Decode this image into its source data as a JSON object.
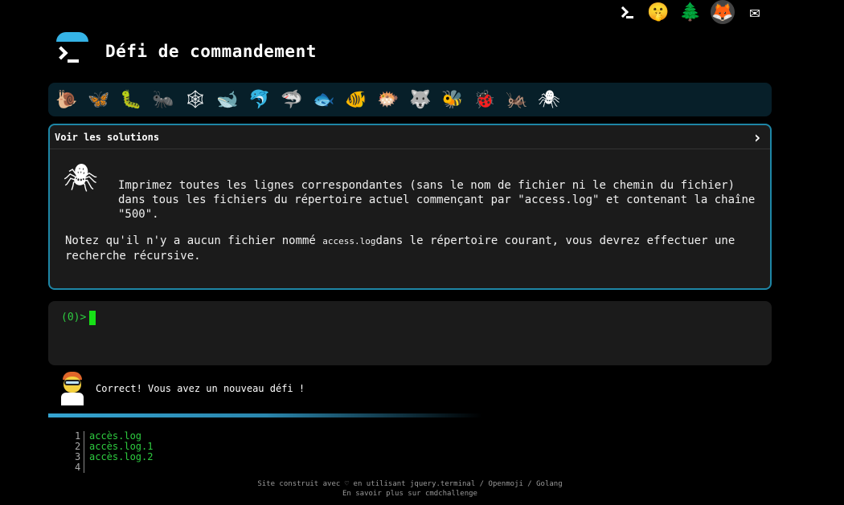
{
  "header": {
    "title": "Défi de commandement"
  },
  "top_icons": [
    {
      "name": "terminal-icon"
    },
    {
      "name": "shush-face-icon",
      "glyph": "🤫"
    },
    {
      "name": "tree-icon",
      "glyph": "🌲"
    },
    {
      "name": "gitlab-icon",
      "glyph": "🦊"
    },
    {
      "name": "mail-icon",
      "glyph": "✉"
    }
  ],
  "animals": [
    {
      "name": "snail-icon",
      "glyph": "🐌"
    },
    {
      "name": "butterfly-icon",
      "glyph": "🦋"
    },
    {
      "name": "caterpillar-icon",
      "glyph": "🐛"
    },
    {
      "name": "ant-icon",
      "glyph": "🐜"
    },
    {
      "name": "spider-web-icon",
      "glyph": "🕸"
    },
    {
      "name": "whale-icon",
      "glyph": "🐋"
    },
    {
      "name": "dolphin-icon",
      "glyph": "🐬"
    },
    {
      "name": "shark-icon",
      "glyph": "🦈"
    },
    {
      "name": "fish-icon",
      "glyph": "🐟"
    },
    {
      "name": "tropical-fish-icon",
      "glyph": "🐠"
    },
    {
      "name": "blowfish-icon",
      "glyph": "🐡"
    },
    {
      "name": "wolf-icon",
      "glyph": "🐺"
    },
    {
      "name": "bee-icon",
      "glyph": "🐝"
    },
    {
      "name": "ladybug-icon",
      "glyph": "🐞"
    },
    {
      "name": "cricket-icon",
      "glyph": "🦗"
    },
    {
      "name": "spider-icon",
      "glyph": "🕷"
    }
  ],
  "panel": {
    "heading": "Voir les solutions",
    "chevron": "›",
    "spider_glyph": "🕷",
    "description": "Imprimez toutes les lignes correspondantes (sans le nom de fichier ni le chemin du fichier) dans tous les fichiers du répertoire actuel commençant par \"access.log\" et contenant la chaîne \"500\".",
    "note_before": "Notez qu'il n'y a aucun fichier nommé ",
    "note_code": "access.log",
    "note_after": "dans le répertoire courant, vous devrez effectuer une recherche récursive."
  },
  "terminal": {
    "prompt": "(0)>"
  },
  "feedback": {
    "message": "Correct! Vous avez un nouveau défi !"
  },
  "progress": 0.55,
  "listing": [
    {
      "n": "1",
      "text": "accès.log"
    },
    {
      "n": "2",
      "text": "accès.log.1"
    },
    {
      "n": "3",
      "text": "accès.log.2"
    },
    {
      "n": "4",
      "text": ""
    }
  ],
  "footer": {
    "line1": "Site construit avec ♡ en utilisant jquery.terminal / Openmoji / Golang",
    "line2": "En savoir plus sur cmdchallenge"
  },
  "colors": {
    "accent": "#1e86a6",
    "prompt_green": "#2ecc40",
    "panel_bg": "#1b1b1b"
  }
}
